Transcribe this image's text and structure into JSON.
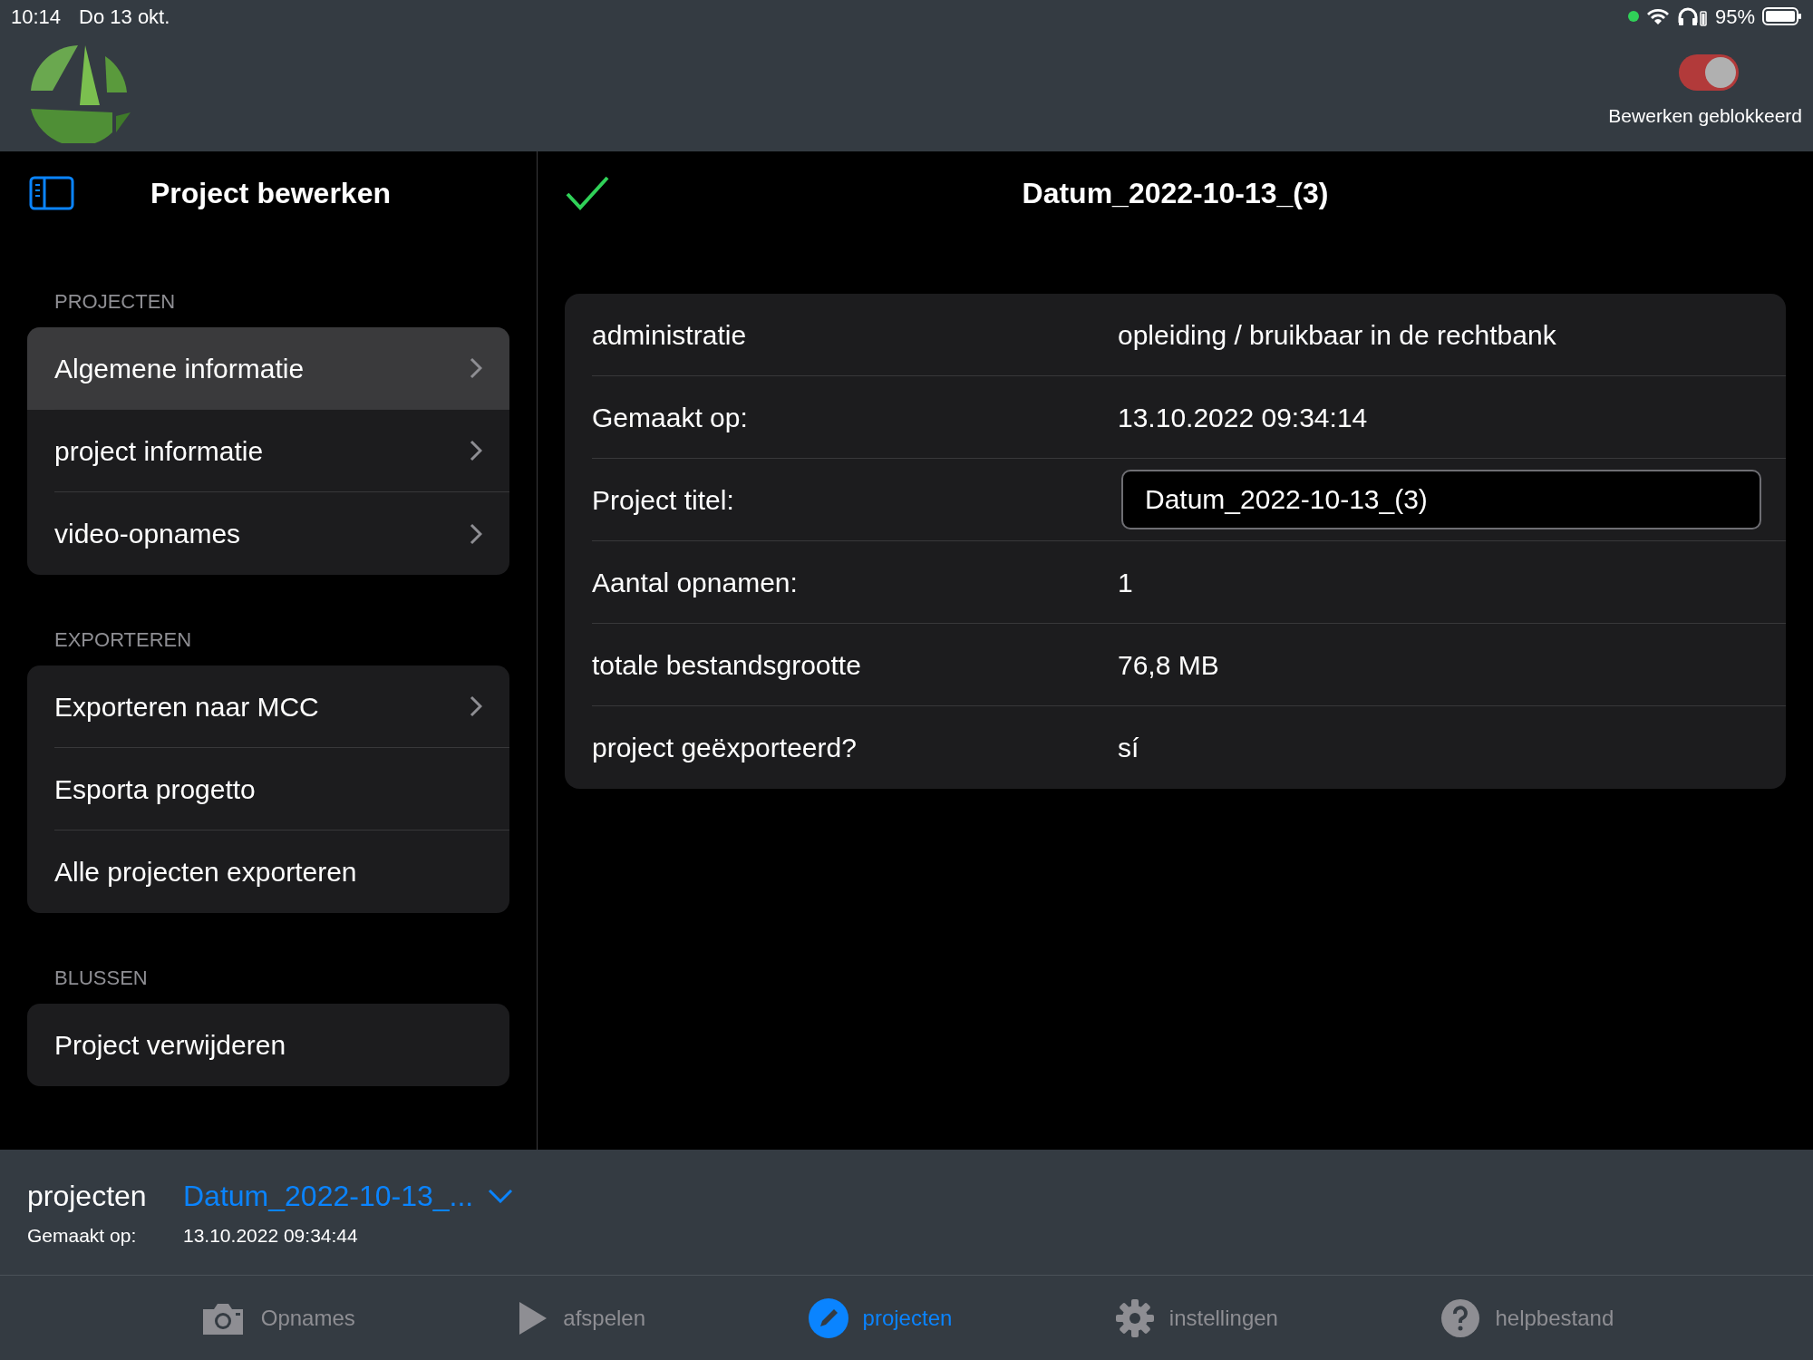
{
  "status_bar": {
    "time": "10:14",
    "date": "Do 13 okt.",
    "battery": "95%"
  },
  "header": {
    "toggle": {
      "label": "Bewerken geblokkeerd",
      "on": true
    }
  },
  "sidebar": {
    "title": "Project bewerken",
    "sections": [
      {
        "header": "PROJECTEN",
        "items": [
          {
            "label": "Algemene informatie",
            "chevron": true,
            "selected": true
          },
          {
            "label": "project informatie",
            "chevron": true,
            "selected": false
          },
          {
            "label": "video-opnames",
            "chevron": true,
            "selected": false
          }
        ]
      },
      {
        "header": "EXPORTEREN",
        "items": [
          {
            "label": "Exporteren naar MCC",
            "chevron": true,
            "selected": false
          },
          {
            "label": "Esporta progetto",
            "chevron": false,
            "selected": false
          },
          {
            "label": "Alle projecten exporteren",
            "chevron": false,
            "selected": false
          }
        ]
      },
      {
        "header": "BLUSSEN",
        "items": [
          {
            "label": "Project verwijderen",
            "chevron": false,
            "selected": false
          }
        ]
      }
    ]
  },
  "detail": {
    "title": "Datum_2022-10-13_(3)",
    "rows": [
      {
        "kind": "text",
        "label": "administratie",
        "value": "opleiding / bruikbaar in de rechtbank"
      },
      {
        "kind": "text",
        "label": "Gemaakt op:",
        "value": "13.10.2022 09:34:14"
      },
      {
        "kind": "field",
        "label": "Project titel:",
        "value": "Datum_2022-10-13_(3)"
      },
      {
        "kind": "text",
        "label": "Aantal opnamen:",
        "value": "1"
      },
      {
        "kind": "text",
        "label": "totale bestandsgrootte",
        "value": "76,8 MB"
      },
      {
        "kind": "text",
        "label": "project geëxporteerd?",
        "value": "sí"
      }
    ]
  },
  "project_bar": {
    "label": "projecten",
    "selected_project": "Datum_2022-10-13_...",
    "created_label": "Gemaakt op:",
    "created_value": "13.10.2022 09:34:44"
  },
  "tab_bar": [
    {
      "kind": "camera",
      "label": "Opnames",
      "selected": false
    },
    {
      "kind": "play",
      "label": "afspelen",
      "selected": false
    },
    {
      "kind": "pencil",
      "label": "projecten",
      "selected": true
    },
    {
      "kind": "gear",
      "label": "instellingen",
      "selected": false
    },
    {
      "kind": "help",
      "label": "helpbestand",
      "selected": false
    }
  ]
}
